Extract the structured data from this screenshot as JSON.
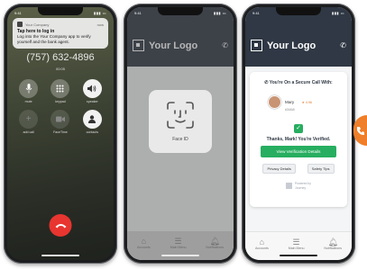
{
  "status_bar": {
    "time": "9:41"
  },
  "phone1": {
    "notification": {
      "app": "Your Company",
      "time": "now",
      "title": "Tap here to log in",
      "body": "Log into the Your Company app to verify yourself and the bank agent."
    },
    "phone_number": "(757) 632-4896",
    "call_timer": "00:05",
    "keys": [
      {
        "icon": "microphone-mute-icon",
        "label": "mute"
      },
      {
        "icon": "keypad-icon",
        "label": "keypad"
      },
      {
        "icon": "speaker-icon",
        "label": "speaker"
      },
      {
        "icon": "add-call-icon",
        "label": "add call"
      },
      {
        "icon": "facetime-icon",
        "label": "FaceTime"
      },
      {
        "icon": "contacts-icon",
        "label": "contacts"
      }
    ],
    "end_call_color": "#e8352f"
  },
  "app": {
    "logo_text": "Your Logo",
    "header_color": "#2f3844",
    "accent_color": "#27ae60",
    "tabs": [
      {
        "icon": "home-icon",
        "label": "Accounts"
      },
      {
        "icon": "menu-icon",
        "label": "Main Menu"
      },
      {
        "icon": "bell-icon",
        "label": "Notifications"
      }
    ]
  },
  "phone2": {
    "faceid_label": "Face ID"
  },
  "phone3": {
    "secure_title": "You're On a Secure Call With:",
    "agent_name": "Mary",
    "agent_id": "#3468",
    "agent_rating": "★ 4.96",
    "verified_text": "Thanks, Mark! You're Verified.",
    "verify_button": "View Verification Details",
    "privacy_button": "Privacy Details",
    "safety_button": "Safety Tips",
    "powered_by": "Powered by",
    "powered_brand": "Journey"
  },
  "side_badge_color": "#ef7f2a"
}
